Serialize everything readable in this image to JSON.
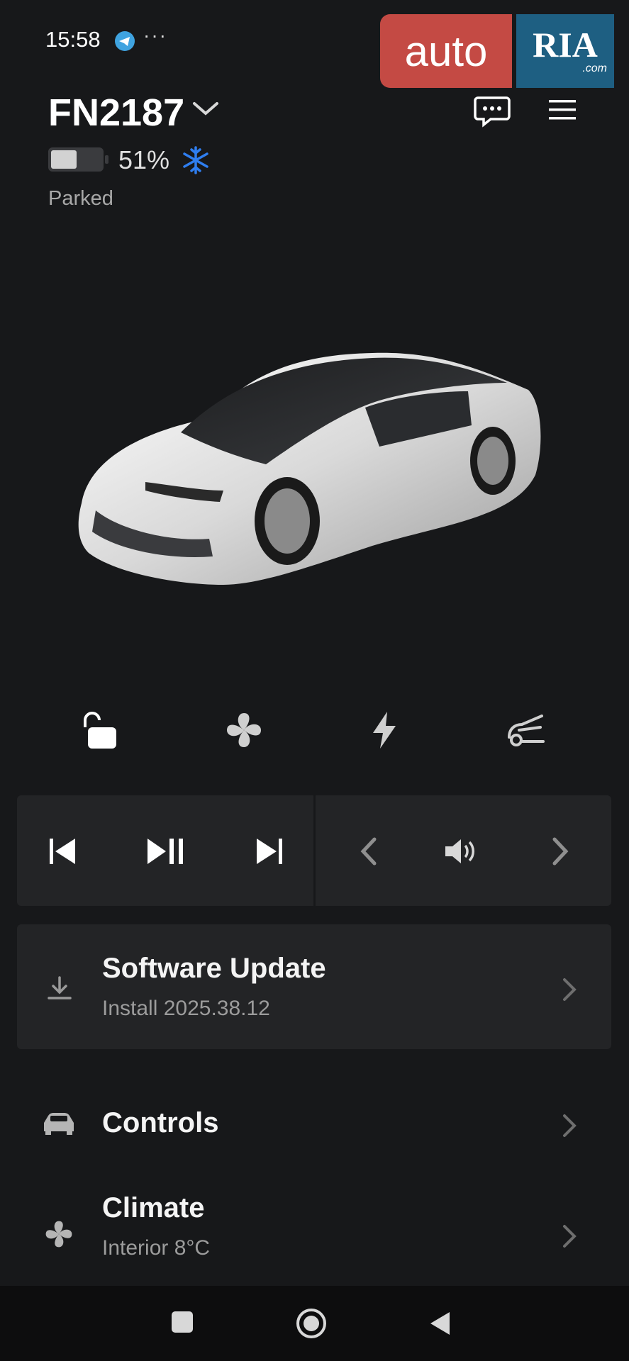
{
  "status_bar": {
    "time": "15:58",
    "more": "···",
    "icons": [
      "telegram-icon"
    ]
  },
  "watermark": {
    "auto": "auto",
    "ria": "RIA",
    "com": ".com"
  },
  "header": {
    "car_name": "FN2187",
    "battery_percent": "51%",
    "battery_level": 0.51,
    "status": "Parked",
    "icons": [
      "chevron-down-icon",
      "chat-icon",
      "menu-icon",
      "snowflake-icon"
    ]
  },
  "quick_actions": [
    {
      "name": "unlock",
      "icon": "unlock-icon"
    },
    {
      "name": "climate",
      "icon": "fan-icon"
    },
    {
      "name": "charge",
      "icon": "bolt-icon"
    },
    {
      "name": "frunk",
      "icon": "frunk-icon"
    }
  ],
  "media": {
    "buttons": [
      "previous-track-icon",
      "play-pause-icon",
      "next-track-icon",
      "source-previous-icon",
      "volume-icon",
      "source-next-icon"
    ]
  },
  "software_update": {
    "title": "Software Update",
    "subtitle": "Install 2025.38.12"
  },
  "controls": {
    "title": "Controls"
  },
  "climate": {
    "title": "Climate",
    "subtitle": "Interior 8°C"
  },
  "colors": {
    "background": "#17181a",
    "card": "#232426",
    "snow_accent": "#2f7ef0",
    "watermark_red": "#c44a44",
    "watermark_blue": "#1e5f82"
  }
}
